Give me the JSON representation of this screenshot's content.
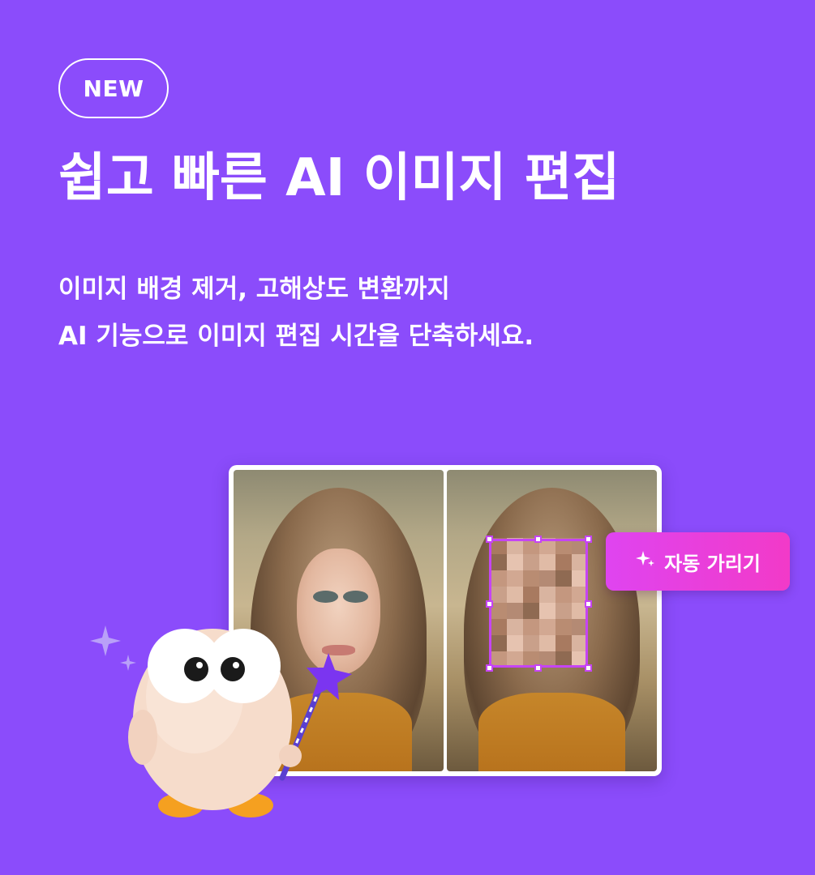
{
  "badge": {
    "label": "NEW"
  },
  "headline": {
    "title": "쉽고 빠른 AI 이미지 편집"
  },
  "description": {
    "line1": "이미지 배경 제거, 고해상도 변환까지",
    "line2": "AI 기능으로 이미지 편집 시간을 단축하세요."
  },
  "feature_button": {
    "label": "자동 가리기",
    "icon": "sparkle-icon"
  },
  "colors": {
    "background": "#8b4cfb",
    "accent_pink": "#df44f0",
    "selection": "#c644f4"
  }
}
